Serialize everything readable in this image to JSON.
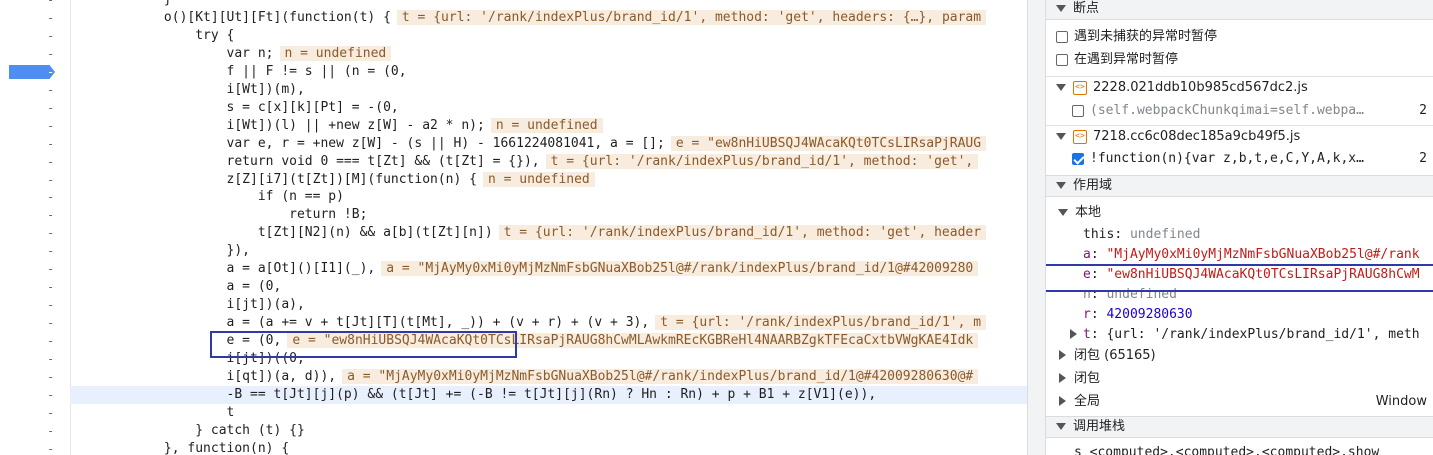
{
  "code_lines": [
    {
      "text": "            }",
      "ann": ""
    },
    {
      "text": "            o()[Kt][Ut][Ft](function(t) {",
      "ann": "t = {url: '/rank/indexPlus/brand_id/1', method: 'get', headers: {…}, param"
    },
    {
      "text": "                try {",
      "ann": ""
    },
    {
      "text": "                    var n;",
      "ann": "n = undefined"
    },
    {
      "text": "                    f || F != s || (n = (0,",
      "ann": "",
      "breakpoint": true
    },
    {
      "text": "                    i[Wt])(m),",
      "ann": ""
    },
    {
      "text": "                    s = c[x][k][Pt] = -(0,",
      "ann": ""
    },
    {
      "text": "                    i[Wt])(l) || +new z[W] - a2 * n);",
      "ann": "n = undefined"
    },
    {
      "text": "                    var e, r = +new z[W] - (s || H) - 1661224081041, a = [];",
      "ann": "e = \"ew8nHiUBSQJ4WAcaKQt0TCsLIRsaPjRAUG"
    },
    {
      "text": "                    return void 0 === t[Zt] && (t[Zt] = {}),",
      "ann": "t = {url: '/rank/indexPlus/brand_id/1', method: 'get',"
    },
    {
      "text": "                    z[Z][i7](t[Zt])[M](function(n) {",
      "ann": "n = undefined"
    },
    {
      "text": "                        if (n == p)",
      "ann": ""
    },
    {
      "text": "                            return !B;",
      "ann": ""
    },
    {
      "text": "                        t[Zt][N2](n) && a[b](t[Zt][n])",
      "ann": "t = {url: '/rank/indexPlus/brand_id/1', method: 'get', header"
    },
    {
      "text": "                    }),",
      "ann": ""
    },
    {
      "text": "                    a = a[Ot]()[I1](_),",
      "ann": "a = \"MjAyMy0xMi0yMjMzNmFsbGNuaXBob25l@#/rank/indexPlus/brand_id/1@#42009280"
    },
    {
      "text": "                    a = (0,",
      "ann": ""
    },
    {
      "text": "                    i[jt])(a),",
      "ann": ""
    },
    {
      "text": "                    a = (a += v + t[Jt][T](t[Mt], _)) + (v + r) + (v + 3),",
      "ann": "t = {url: '/rank/indexPlus/brand_id/1', m"
    },
    {
      "text": "                    e = (0,",
      "ann": "e = \"ew8nHiUBSQJ4WAcaKQt0TCsLIRsaPjRAUG8hCwMLAwkmREcKGBReHl4NAARBZgkTFEcaCxtbVWgKAE4Idk"
    },
    {
      "text": "                    i[jt])((0,",
      "ann": ""
    },
    {
      "text": "                    i[qt])(a, d)),",
      "ann": "a = \"MjAyMy0xMi0yMjMzNmFsbGNuaXBob25l@#/rank/indexPlus/brand_id/1@#42009280630@#"
    },
    {
      "text": "                    -B == t[Jt][j](p) && (t[Jt] += (-B != t[Jt][j](Rn) ? Hn : Rn) + p + B1 + z[V1](e)),",
      "ann": "",
      "current": true
    },
    {
      "text": "                    t",
      "ann": ""
    },
    {
      "text": "                } catch (t) {}",
      "ann": ""
    },
    {
      "text": "            }, function(n) {",
      "ann": ""
    }
  ],
  "sidebar": {
    "breakpoints_header": "断点",
    "pause_uncaught": "遇到未捕获的异常时暂停",
    "pause_caught": "在遇到异常时暂停",
    "file1": {
      "name": "2228.021ddb10b985cd567dc2.js",
      "snippet": "(self.webpackChunkqimai=self.webpa…",
      "line": "2"
    },
    "file2": {
      "name": "7218.cc6c08dec185a9cb49f5.js",
      "snippet": "!function(n){var z,b,t,e,C,Y,A,k,x…",
      "line": "2"
    },
    "scope_header": "作用域",
    "local_label": "本地",
    "vars": [
      {
        "key": "this",
        "sep": ": ",
        "value": "undefined",
        "kind": "gray"
      },
      {
        "key": "a",
        "sep": ": ",
        "value": "\"MjAyMy0xMi0yMjMzNmFsbGNuaXBob25l@#/rank",
        "kind": "str"
      },
      {
        "key": "e",
        "sep": ": ",
        "value": "\"ew8nHiUBSQJ4WAcaKQt0TCsLIRsaPjRAUG8hCwM",
        "kind": "str"
      },
      {
        "key": "n",
        "sep": ": ",
        "value": "undefined",
        "kind": "gray"
      },
      {
        "key": "r",
        "sep": ": ",
        "value": "42009280630",
        "kind": "num"
      },
      {
        "key": "t",
        "sep": ": ",
        "value": "{url: '/rank/indexPlus/brand_id/1', meth",
        "kind": "plain"
      }
    ],
    "closure1": "闭包 (65165)",
    "closure2": "闭包",
    "global_label": "全局",
    "global_value": "Window",
    "callstack_header": "调用堆栈",
    "callstack_first": "s <computed>.<computed>.<computed>.show"
  }
}
